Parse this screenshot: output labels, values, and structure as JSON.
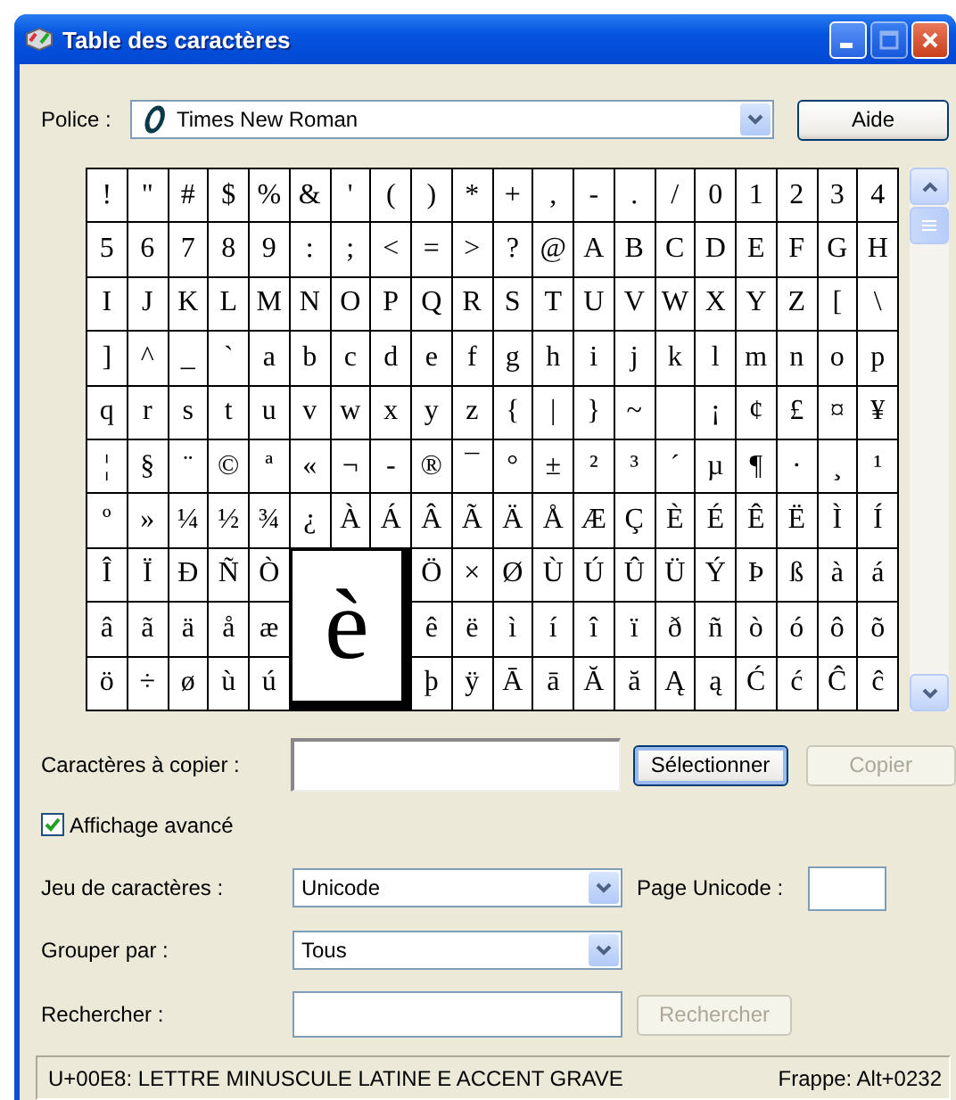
{
  "window": {
    "title": "Table des caractères"
  },
  "font": {
    "label": "Police :",
    "value": "Times New Roman"
  },
  "help_button": {
    "label": "Aide"
  },
  "grid": {
    "magnified": "è",
    "rows": [
      [
        "!",
        "\"",
        "#",
        "$",
        "%",
        "&",
        "'",
        "(",
        ")",
        "*",
        "+",
        ",",
        "-",
        ".",
        "/",
        "0",
        "1",
        "2",
        "3",
        "4"
      ],
      [
        "5",
        "6",
        "7",
        "8",
        "9",
        ":",
        ";",
        "<",
        "=",
        ">",
        "?",
        "@",
        "A",
        "B",
        "C",
        "D",
        "E",
        "F",
        "G",
        "H"
      ],
      [
        "I",
        "J",
        "K",
        "L",
        "M",
        "N",
        "O",
        "P",
        "Q",
        "R",
        "S",
        "T",
        "U",
        "V",
        "W",
        "X",
        "Y",
        "Z",
        "[",
        "\\"
      ],
      [
        "]",
        "^",
        "_",
        "`",
        "a",
        "b",
        "c",
        "d",
        "e",
        "f",
        "g",
        "h",
        "i",
        "j",
        "k",
        "l",
        "m",
        "n",
        "o",
        "p"
      ],
      [
        "q",
        "r",
        "s",
        "t",
        "u",
        "v",
        "w",
        "x",
        "y",
        "z",
        "{",
        "|",
        "}",
        "~",
        null,
        "¡",
        "¢",
        "£",
        "¤",
        "¥"
      ],
      [
        "¦",
        "§",
        "¨",
        "©",
        "ª",
        "«",
        "¬",
        "-",
        "®",
        "¯",
        "°",
        "±",
        "²",
        "³",
        "´",
        "µ",
        "¶",
        "·",
        "¸",
        "¹"
      ],
      [
        "º",
        "»",
        "¼",
        "½",
        "¾",
        "¿",
        "À",
        "Á",
        "Â",
        "Ã",
        "Ä",
        "Å",
        "Æ",
        "Ç",
        "È",
        "É",
        "Ê",
        "Ë",
        "Ì",
        "Í"
      ],
      [
        "Î",
        "Ï",
        "Ð",
        "Ñ",
        "Ò",
        null,
        null,
        null,
        "Ö",
        "×",
        "Ø",
        "Ù",
        "Ú",
        "Û",
        "Ü",
        "Ý",
        "Þ",
        "ß",
        "à",
        "á"
      ],
      [
        "â",
        "ã",
        "ä",
        "å",
        "æ",
        null,
        null,
        null,
        "ê",
        "ë",
        "ì",
        "í",
        "î",
        "ï",
        "ð",
        "ñ",
        "ò",
        "ó",
        "ô",
        "õ"
      ],
      [
        "ö",
        "÷",
        "ø",
        "ù",
        "ú",
        null,
        null,
        null,
        "þ",
        "ÿ",
        "Ā",
        "ā",
        "Ă",
        "ă",
        "Ą",
        "ą",
        "Ć",
        "ć",
        "Ĉ",
        "ĉ"
      ]
    ]
  },
  "copy": {
    "label": "Caractères à copier :"
  },
  "select_button": {
    "label": "Sélectionner",
    "disabled": false
  },
  "copy_button": {
    "label": "Copier",
    "disabled": true
  },
  "advanced_view": {
    "label": "Affichage avancé",
    "checked": true
  },
  "charset": {
    "label": "Jeu de caractères :",
    "value": "Unicode"
  },
  "unicode_page": {
    "label": "Page Unicode :"
  },
  "group_by": {
    "label": "Grouper par :",
    "value": "Tous"
  },
  "search": {
    "label": "Rechercher :",
    "button": {
      "label": "Rechercher",
      "disabled": true
    }
  },
  "status_bar": {
    "description": "U+00E8: LETTRE MINUSCULE LATINE E ACCENT GRAVE",
    "keystroke": "Frappe: Alt+0232"
  }
}
